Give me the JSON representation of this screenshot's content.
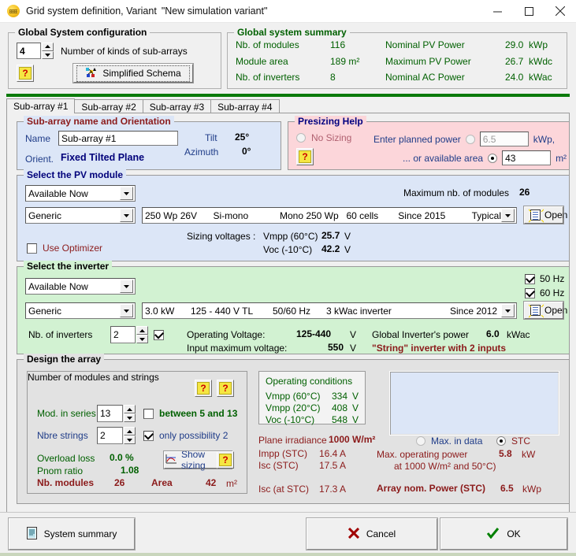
{
  "window": {
    "title": "Grid system definition, Variant",
    "variant": "\"New simulation variant\"",
    "app_icon": "pvsyst-app-icon",
    "minimize": "minimize-icon",
    "maximize": "maximize-icon",
    "close": "close-icon"
  },
  "global_config": {
    "legend": "Global System configuration",
    "kinds_value": "4",
    "kinds_label": "Number of kinds of sub-arrays",
    "help": "?",
    "schema_button": "Simplified Schema"
  },
  "global_summary": {
    "legend": "Global system summary",
    "rows": [
      {
        "label": "Nb. of modules",
        "value": "116",
        "label2": "Nominal PV Power",
        "value2": "29.0",
        "unit2": "kWp"
      },
      {
        "label": "Module area",
        "value": "189 m²",
        "label2": "Maximum PV Power",
        "value2": "26.7",
        "unit2": "kWdc"
      },
      {
        "label": "Nb. of inverters",
        "value": "8",
        "label2": "Nominal AC Power",
        "value2": "24.0",
        "unit2": "kWac"
      }
    ]
  },
  "tabs": [
    {
      "label": "Sub-array #1",
      "active": true
    },
    {
      "label": "Sub-array #2",
      "active": false
    },
    {
      "label": "Sub-array #3",
      "active": false
    },
    {
      "label": "Sub-array #4",
      "active": false
    }
  ],
  "subarray_orientation": {
    "legend": "Sub-array name and Orientation",
    "name_label": "Name",
    "name_value": "Sub-array #1",
    "orient_label": "Orient.",
    "orient_value": "Fixed Tilted Plane",
    "tilt_label": "Tilt",
    "tilt_value": "25°",
    "azimuth_label": "Azimuth",
    "azimuth_value": "0°"
  },
  "presizing": {
    "legend": "Presizing Help",
    "no_sizing_label": "No Sizing",
    "no_sizing_selected": false,
    "help": "?",
    "planned_power_label": "Enter planned power",
    "planned_power_value": "6.5",
    "planned_power_unit": "kWp,",
    "planned_power_selected": false,
    "available_area_label": "... or available area",
    "available_area_value": "43",
    "available_area_unit": "m²",
    "available_area_selected": true
  },
  "pv_module": {
    "legend": "Select the PV module",
    "availability": "Available Now",
    "max_modules_label": "Maximum nb. of modules",
    "max_modules_value": "26",
    "manufacturer": "Generic",
    "model_power": "250 Wp 26V",
    "model_tech": "Si-mono",
    "model_desc": "Mono 250 Wp",
    "model_cells": "60 cells",
    "model_since": "Since 2015",
    "model_quality": "Typical",
    "open_label": "Open",
    "sizing_voltages_label": "Sizing voltages :",
    "vmpp_label": "Vmpp (60°C)",
    "vmpp_value": "25.7",
    "vmpp_unit": "V",
    "voc_label": "Voc  (-10°C)",
    "voc_value": "42.2",
    "voc_unit": "V",
    "optimizer_label": "Use Optimizer",
    "optimizer_checked": false
  },
  "inverter": {
    "legend": "Select the inverter",
    "availability": "Available Now",
    "hz50_label": "50 Hz",
    "hz50_checked": true,
    "hz60_label": "60 Hz",
    "hz60_checked": true,
    "manufacturer": "Generic",
    "model_power": "3.0 kW",
    "model_voltage": "125 - 440 V  TL",
    "model_freq": "50/60 Hz",
    "model_desc": "3 kWac inverter",
    "model_since": "Since 2012",
    "open_label": "Open",
    "nb_inverters_label": "Nb. of inverters",
    "nb_inverters_value": "2",
    "nb_inverters_checked": true,
    "operating_voltage_label": "Operating Voltage:",
    "operating_voltage_value": "125-440",
    "operating_voltage_unit": "V",
    "input_max_voltage_label": "Input maximum voltage:",
    "input_max_voltage_value": "550",
    "input_max_voltage_unit": "V",
    "global_power_label": "Global Inverter's power",
    "global_power_value": "6.0",
    "global_power_unit": "kWac",
    "string_note": "\"String\" inverter with 2 inputs"
  },
  "design": {
    "legend": "Design the array",
    "modules_strings": {
      "legend": "Number of modules and strings",
      "help1": "?",
      "help2": "?",
      "help3": "?",
      "mod_series_label": "Mod. in series",
      "mod_series_value": "13",
      "between_label": "between 5 and 13",
      "between_checked": false,
      "nbre_strings_label": "Nbre strings",
      "nbre_strings_value": "2",
      "only_possibility_label": "only possibility 2",
      "only_possibility_checked": true,
      "overload_loss_label": "Overload loss",
      "overload_loss_value": "0.0 %",
      "pnom_ratio_label": "Pnom ratio",
      "pnom_ratio_value": "1.08",
      "show_sizing_label": "Show sizing",
      "nb_modules_label": "Nb. modules",
      "nb_modules_value": "26",
      "area_label": "Area",
      "area_value": "42",
      "area_unit": "m²"
    },
    "operating_conditions": {
      "title": "Operating conditions",
      "rows": [
        {
          "label": "Vmpp (60°C)",
          "value": "334",
          "unit": "V"
        },
        {
          "label": "Vmpp (20°C)",
          "value": "408",
          "unit": "V"
        },
        {
          "label": "Voc  (-10°C)",
          "value": "548",
          "unit": "V"
        }
      ]
    },
    "plane_irradiance_label": "Plane irradiance",
    "plane_irradiance_value": "1000 W/m²",
    "impp_label": "Impp (STC)",
    "impp_value": "16.4 A",
    "isc_label": "Isc  (STC)",
    "isc_value": "17.5 A",
    "isc_at_stc_label": "Isc (at STC)",
    "isc_at_stc_value": "17.3 A",
    "max_in_data_label": "Max. in data",
    "max_in_data_selected": false,
    "stc_label": "STC",
    "stc_selected": true,
    "max_operating_power_label": "Max. operating power",
    "max_operating_power_sub": "at 1000 W/m² and 50°C)",
    "max_operating_power_value": "5.8",
    "max_operating_power_unit": "kW",
    "array_nom_power_label": "Array nom. Power (STC)",
    "array_nom_power_value": "6.5",
    "array_nom_power_unit": "kWp"
  },
  "footer": {
    "system_summary": "System summary",
    "cancel": "Cancel",
    "ok": "OK"
  },
  "colors": {
    "green_text": "#006000",
    "dark_red": "#8b1a1a",
    "blue_label": "#1f3c88",
    "pink_panel": "#fcd6da",
    "blue_panel": "#dce6f7",
    "green_panel": "#d2f2d2"
  }
}
